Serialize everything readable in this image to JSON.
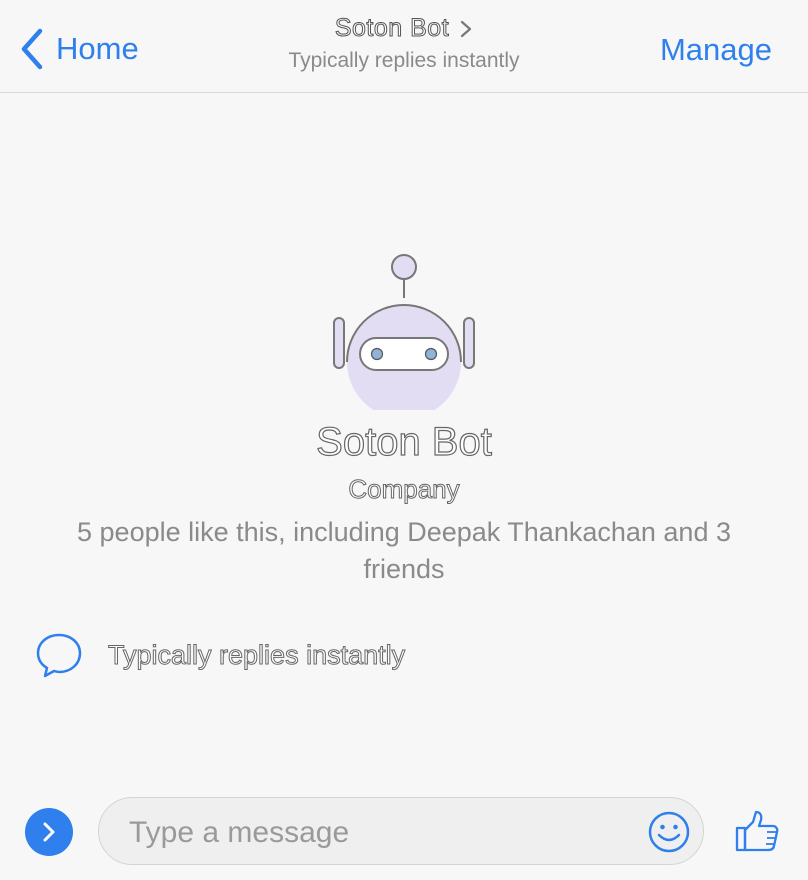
{
  "header": {
    "back_label": "Home",
    "title": "Soton Bot",
    "subtitle": "Typically replies instantly",
    "manage_label": "Manage"
  },
  "profile": {
    "name": "Soton Bot",
    "category": "Company",
    "likes_text": "5 people like this, including Deepak Thankachan and 3 friends"
  },
  "info": {
    "reply_time": "Typically replies instantly"
  },
  "composer": {
    "placeholder": "Type a message"
  },
  "icons": {
    "back": "chevron-left-icon",
    "title_chevron": "chevron-right-icon",
    "avatar": "robot-icon",
    "reply": "chat-bubble-icon",
    "toggle": "chevron-right-icon",
    "emoji": "smiley-icon",
    "like": "thumbs-up-icon"
  },
  "colors": {
    "accent": "#2f80ed",
    "robot_body": "#e3ddf3",
    "robot_eyes": "#8fb3d9"
  }
}
